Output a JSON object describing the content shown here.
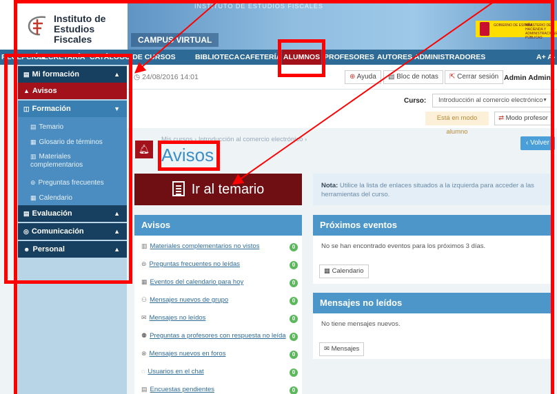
{
  "header": {
    "logo_line1": "Instituto de",
    "logo_line2": "Estudios Fiscales",
    "campus": "CAMPUS VIRTUAL",
    "banner_caption": "INSTITUTO DE ESTUDIOS FISCALES",
    "gov_text1": "GOBIERNO DE ESPAÑA",
    "gov_text2": "MINISTERIO DE HACIENDA Y ADMINISTRACIONES PÚBLICAS"
  },
  "nav": {
    "items": [
      "RECEPCIÓN",
      "SECRETARÍA",
      "CATÁLOGO DE CURSOS",
      "BIBLIOTECA",
      "CAFETERÍA",
      "ALUMNOS",
      "PROFESORES",
      "AUTORES",
      "ADMINISTRADORES"
    ],
    "font_size": "A+ A-"
  },
  "sidebar": {
    "mi_formacion": "Mi formación",
    "avisos": "Avisos",
    "formacion": "Formación",
    "subitems": [
      "Temario",
      "Glosario de términos",
      "Materiales complementarios",
      "Preguntas frecuentes",
      "Calendario"
    ],
    "evaluacion": "Evaluación",
    "comunicacion": "Comunicación",
    "personal": "Personal"
  },
  "topbar": {
    "date": "24/08/2016 14:01",
    "ayuda": "Ayuda",
    "bloc": "Bloc de notas",
    "cerrar": "Cerrar sesión",
    "user": "Admin Admin"
  },
  "course": {
    "label": "Curso:",
    "selected": "Introducción al comercio electrónico",
    "modo_alumno": "Está en modo alumno",
    "modo_profesor": "Modo profesor"
  },
  "page": {
    "breadcrumb": "Mis cursos › Introducción al comercio electrónico ›",
    "title": "Avisos",
    "volver": "Volver",
    "temario_button": "Ir al temario",
    "nota_bold": "Nota:",
    "nota_text": "Utilice la lista de enlaces situados a la izquierda para acceder a las herramientas del curso."
  },
  "avisos_panel": {
    "title": "Avisos",
    "items": [
      {
        "label": "Materiales complementarios no vistos",
        "count": "0",
        "icon": "file-icon"
      },
      {
        "label": "Preguntas frecuentes no leídas",
        "count": "0",
        "icon": "question-icon"
      },
      {
        "label": "Eventos del calendario para hoy",
        "count": "0",
        "icon": "calendar-icon"
      },
      {
        "label": "Mensajes nuevos de grupo",
        "count": "0",
        "icon": "group-icon"
      },
      {
        "label": "Mensajes no leídos",
        "count": "0",
        "icon": "envelope-icon"
      },
      {
        "label": "Preguntas a profesores con respuesta no leída",
        "count": "0",
        "icon": "users-icon"
      },
      {
        "label": "Mensajes nuevos en foros",
        "count": "0",
        "icon": "forum-icon"
      },
      {
        "label": "Usuarios en el chat",
        "count": "0",
        "icon": "chat-icon"
      },
      {
        "label": "Encuestas pendientes",
        "count": "0",
        "icon": "survey-icon"
      }
    ]
  },
  "eventos_panel": {
    "title": "Próximos eventos",
    "text": "No se han encontrado eventos para los próximos 3 días.",
    "button": "Calendario"
  },
  "mensajes_panel": {
    "title": "Mensajes no leídos",
    "text": "No tiene mensajes nuevos.",
    "button": "Mensajes"
  },
  "colors": {
    "nav_bg": "#2e6a96",
    "active_red": "#a3111b",
    "panel_header": "#4c96c9",
    "annotation": "#ff0000"
  }
}
